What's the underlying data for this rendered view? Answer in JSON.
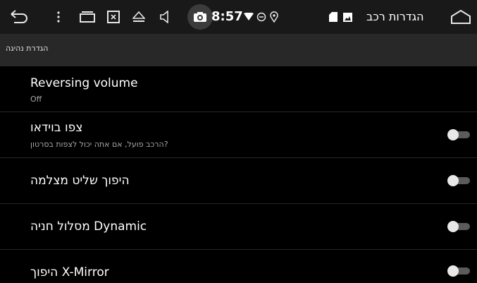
{
  "statusbar": {
    "time": "8:57",
    "app_title": "הגדרות רכב",
    "icons": [
      "back-arrow-icon",
      "more-vertical-icon",
      "recent-apps-icon",
      "close-window-icon",
      "eject-icon",
      "volume-icon",
      "camera-icon",
      "wifi-icon",
      "do-not-disturb-icon",
      "location-icon",
      "sd-card-icon",
      "image-icon",
      "home-icon"
    ]
  },
  "section": {
    "title": "הגדרת נהיגה"
  },
  "settings": [
    {
      "title": "Reversing volume",
      "subtitle": "Off"
    },
    {
      "title": "צפו בוידאו",
      "subtitle": "הרכב פועל, אם אתה יכול לצפות בסרטון?",
      "toggle": false
    },
    {
      "title": "היפוך שליט מצלמה",
      "toggle": false
    },
    {
      "title": "מסלול חניה Dynamic",
      "toggle": false
    },
    {
      "title": "היפוך X-Mirror",
      "toggle": false
    }
  ],
  "colors": {
    "statusbar_bg": "#191919",
    "section_bg": "#282828",
    "list_bg": "#000000",
    "toggle_track": "#5b5b5b",
    "toggle_knob": "#e8e8e8"
  }
}
